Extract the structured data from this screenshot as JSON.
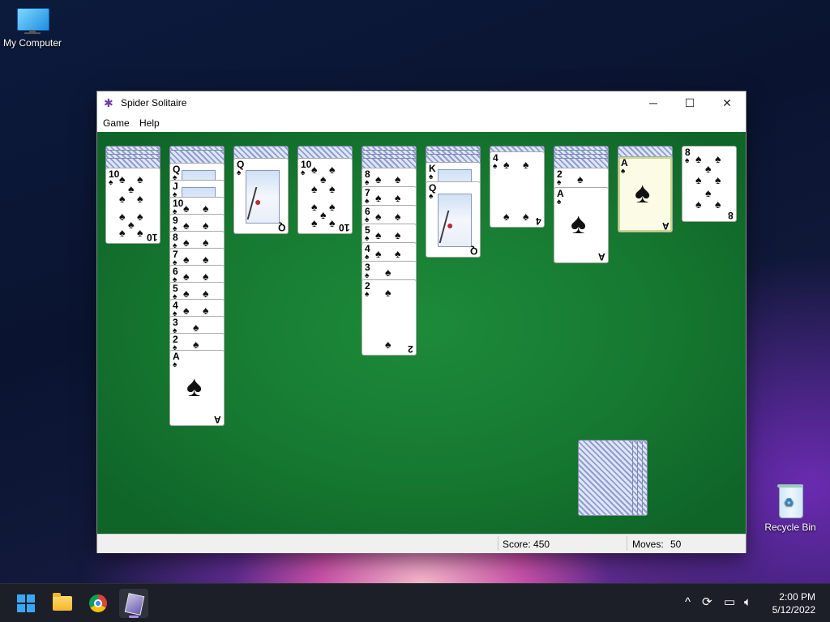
{
  "desktop": {
    "icons": [
      {
        "label": "My Computer",
        "icon": "computer-icon"
      },
      {
        "label": "Recycle Bin",
        "icon": "recycle-bin-icon"
      }
    ]
  },
  "window": {
    "title": "Spider Solitaire",
    "icon": "spider-icon",
    "controls": {
      "minimize": "─",
      "maximize": "☐",
      "close": "✕"
    },
    "menu": [
      "Game",
      "Help"
    ]
  },
  "game": {
    "tableau": [
      {
        "face_down": 4,
        "face_up": [
          "10♠"
        ]
      },
      {
        "face_down": 2,
        "face_up": [
          "Q♠",
          "J♠",
          "10♠",
          "9♠",
          "8♠",
          "7♠",
          "6♠",
          "5♠",
          "4♠",
          "3♠",
          "2♠",
          "A♠"
        ]
      },
      {
        "face_down": 1,
        "face_up": [
          "Q♠"
        ]
      },
      {
        "face_down": 1,
        "face_up": [
          "10♠"
        ]
      },
      {
        "face_down": 4,
        "face_up": [
          "8♠",
          "7♠",
          "6♠",
          "5♠",
          "4♠",
          "3♠",
          "2♠"
        ]
      },
      {
        "face_down": 3,
        "face_up": [
          "K♠",
          "Q♠"
        ]
      },
      {
        "face_down": 1,
        "face_up": [
          "4♠"
        ]
      },
      {
        "face_down": 4,
        "face_up": [
          "2♠",
          "A♠"
        ]
      },
      {
        "face_down": 1,
        "face_up": [
          "A♠"
        ],
        "selected": true
      },
      {
        "face_down": 0,
        "face_up": [
          "8♠"
        ]
      }
    ],
    "stock_piles": 4,
    "suit": "♠"
  },
  "status": {
    "score_label": "Score: 450",
    "moves_label": "Moves:",
    "moves_value": "50"
  },
  "taskbar": {
    "apps": [
      "start-icon",
      "file-explorer-icon",
      "chrome-icon",
      "spider-solitaire-icon"
    ],
    "tray": {
      "chevron": "^",
      "time": "2:00 PM",
      "date": "5/12/2022"
    }
  },
  "colors": {
    "felt": "#167a31",
    "taskbar": "#1c1f28",
    "selected_card": "#fbfbe6"
  }
}
